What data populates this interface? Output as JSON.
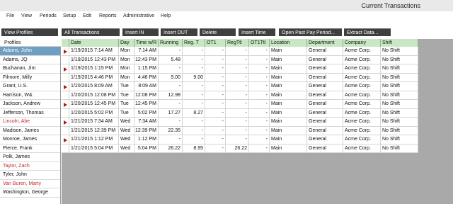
{
  "window": {
    "title": "Current Transactions"
  },
  "menu": [
    "File",
    "View",
    "Periods",
    "Setup",
    "Edit",
    "Reports",
    "Administrative",
    "Help"
  ],
  "toolbar": [
    "View Profiles",
    "All Transactions",
    "Insert IN",
    "Insert OUT",
    "Delete",
    "Insert Time",
    "Open Past Pay Period...",
    "Extract Data..."
  ],
  "profiles": {
    "header": "Profiles",
    "items": [
      {
        "name": "Adams, John",
        "selected": true,
        "red": false
      },
      {
        "name": "Adams, JQ",
        "selected": false,
        "red": false
      },
      {
        "name": "Buchanan, Jim",
        "selected": false,
        "red": false
      },
      {
        "name": "Filmore, Milly",
        "selected": false,
        "red": false
      },
      {
        "name": "Grant, U.S.",
        "selected": false,
        "red": false
      },
      {
        "name": "Harrison, W&",
        "selected": false,
        "red": false
      },
      {
        "name": "Jackson, Andrew",
        "selected": false,
        "red": false
      },
      {
        "name": "Jefferson, Thomas",
        "selected": false,
        "red": false
      },
      {
        "name": "Lincoln, Abe",
        "selected": false,
        "red": true
      },
      {
        "name": "Madison, James",
        "selected": false,
        "red": false
      },
      {
        "name": "Monroe, James",
        "selected": false,
        "red": false
      },
      {
        "name": "Pierce, Frank",
        "selected": false,
        "red": false
      },
      {
        "name": "Polk, James",
        "selected": false,
        "red": false
      },
      {
        "name": "Taylor, Zach",
        "selected": false,
        "red": true
      },
      {
        "name": "Tyler, John",
        "selected": false,
        "red": false
      },
      {
        "name": "Van Buren, Marty",
        "selected": false,
        "red": true
      },
      {
        "name": "Washington, George",
        "selected": false,
        "red": false
      }
    ]
  },
  "table": {
    "columns": [
      "",
      "Date",
      "Day",
      "Time w/R",
      "Running",
      "Reg. T",
      "OT1",
      "RegTtl",
      "OT1Ttl",
      "Location",
      "Department",
      "Company",
      "Shift"
    ],
    "rows": [
      {
        "marker": true,
        "cells": [
          "1/19/2015 7:14 AM",
          "Mon",
          "7:14 AM",
          "-",
          "-",
          "-",
          "-",
          "-",
          "Main",
          "General",
          "Acme Corp.",
          "No Shift"
        ]
      },
      {
        "marker": false,
        "cells": [
          "1/19/2015 12:43 PM",
          "Mon",
          "12:43 PM",
          "5.48",
          "-",
          "-",
          "-",
          "-",
          "Main",
          "General",
          "Acme Corp.",
          "No Shift"
        ]
      },
      {
        "marker": true,
        "cells": [
          "1/19/2015 1:15 PM",
          "Mon",
          "1:15 PM",
          "-",
          "-",
          "-",
          "-",
          "-",
          "Main",
          "General",
          "Acme Corp.",
          "No Shift"
        ]
      },
      {
        "marker": false,
        "cells": [
          "1/19/2015 4:46 PM",
          "Mon",
          "4:46 PM",
          "9.00",
          "9.00",
          "-",
          "-",
          "-",
          "Main",
          "General",
          "Acme Corp.",
          "No Shift"
        ]
      },
      {
        "marker": true,
        "cells": [
          "1/20/2015 8:09 AM",
          "Tue",
          "8:09 AM",
          "-",
          "-",
          "-",
          "-",
          "-",
          "Main",
          "General",
          "Acme Corp.",
          "No Shift"
        ]
      },
      {
        "marker": false,
        "cells": [
          "1/20/2015 12:08 PM",
          "Tue",
          "12:08 PM",
          "12.98",
          "-",
          "-",
          "-",
          "-",
          "Main",
          "General",
          "Acme Corp.",
          "No Shift"
        ]
      },
      {
        "marker": true,
        "cells": [
          "1/20/2015 12:45 PM",
          "Tue",
          "12:45 PM",
          "-",
          "-",
          "-",
          "-",
          "-",
          "Main",
          "General",
          "Acme Corp.",
          "No Shift"
        ]
      },
      {
        "marker": false,
        "cells": [
          "1/20/2015 5:02 PM",
          "Tue",
          "5:02 PM",
          "17.27",
          "8.27",
          "-",
          "-",
          "-",
          "Main",
          "General",
          "Acme Corp.",
          "No Shift"
        ]
      },
      {
        "marker": true,
        "cells": [
          "1/21/2015 7:34 AM",
          "Wed",
          "7:34 AM",
          "-",
          "-",
          "-",
          "-",
          "-",
          "Main",
          "General",
          "Acme Corp.",
          "No Shift"
        ]
      },
      {
        "marker": false,
        "cells": [
          "1/21/2015 12:39 PM",
          "Wed",
          "12:39 PM",
          "22.35",
          "-",
          "-",
          "-",
          "-",
          "Main",
          "General",
          "Acme Corp.",
          "No Shift"
        ]
      },
      {
        "marker": true,
        "cells": [
          "1/21/2015 1:12 PM",
          "Wed",
          "1:12 PM",
          "-",
          "-",
          "-",
          "-",
          "-",
          "Main",
          "General",
          "Acme Corp.",
          "No Shift"
        ]
      },
      {
        "marker": false,
        "cells": [
          "1/21/2015 5:04 PM",
          "Wed",
          "5:04 PM",
          "26.22",
          "8.95",
          "-",
          "26.22",
          "-",
          "Main",
          "General",
          "Acme Corp.",
          "No Shift"
        ]
      }
    ]
  },
  "colors": {
    "header_green": "#c9e7c4",
    "selected_blue": "#6e9fc2",
    "toolbar_dark": "#3f3f3f",
    "marker_red": "#b01818",
    "name_red": "#c62828",
    "empty_grid": "#a9a9a9"
  },
  "icons": {
    "row_marker": "red-triangle-icon"
  }
}
